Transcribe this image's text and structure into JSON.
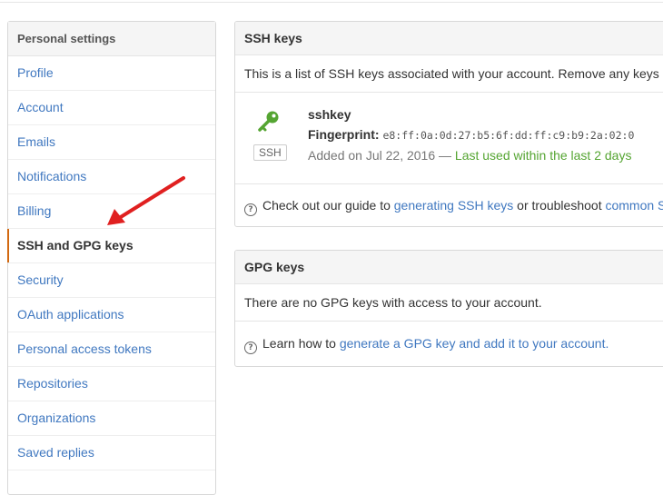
{
  "sidebar": {
    "title": "Personal settings",
    "items": [
      {
        "label": "Profile"
      },
      {
        "label": "Account"
      },
      {
        "label": "Emails"
      },
      {
        "label": "Notifications"
      },
      {
        "label": "Billing"
      },
      {
        "label": "SSH and GPG keys",
        "selected": true
      },
      {
        "label": "Security"
      },
      {
        "label": "OAuth applications"
      },
      {
        "label": "Personal access tokens"
      },
      {
        "label": "Repositories"
      },
      {
        "label": "Organizations"
      },
      {
        "label": "Saved replies"
      }
    ]
  },
  "ssh": {
    "title": "SSH keys",
    "description": "This is a list of SSH keys associated with your account. Remove any keys",
    "key": {
      "name": "sshkey",
      "badge": "SSH",
      "fingerprint_label": "Fingerprint:",
      "fingerprint": "e8:ff:0a:0d:27:b5:6f:dd:ff:c9:b9:2a:02:0",
      "added": "Added on Jul 22, 2016 — ",
      "last_used": "Last used within the last 2 days"
    },
    "help_prefix": "Check out our guide to ",
    "help_link1": "generating SSH keys",
    "help_mid": " or troubleshoot ",
    "help_link2": "common S"
  },
  "gpg": {
    "title": "GPG keys",
    "empty": "There are no GPG keys with access to your account.",
    "help_prefix": "Learn how to ",
    "help_link": "generate a GPG key and add it to your account."
  },
  "colors": {
    "link": "#4078c0",
    "key_icon": "#55a532",
    "annotation_arrow": "#e02020",
    "selected_marker": "#d26911"
  },
  "icons": {
    "key": "key-icon",
    "help": "question-circle-icon",
    "annotation": "red-arrow"
  }
}
